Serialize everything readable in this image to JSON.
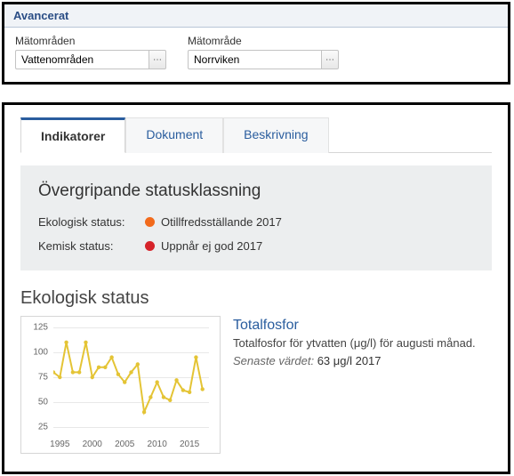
{
  "top": {
    "header": "Avancerat",
    "field1_label": "Mätområden",
    "field1_value": "Vattenområden",
    "field2_label": "Mätområde",
    "field2_value": "Norrviken"
  },
  "tabs": [
    {
      "label": "Indikatorer"
    },
    {
      "label": "Dokument"
    },
    {
      "label": "Beskrivning"
    }
  ],
  "status": {
    "title": "Övergripande statusklassning",
    "eco_label": "Ekologisk status:",
    "eco_value": "Otillfredsställande 2017",
    "chem_label": "Kemisk status:",
    "chem_value": "Uppnår ej god 2017"
  },
  "section_heading": "Ekologisk status",
  "indicator": {
    "title": "Totalfosfor",
    "desc": "Totalfosfor för ytvatten (μg/l) för augusti månad.",
    "latest_label": "Senaste värdet:",
    "latest_value": "63 μg/l 2017"
  },
  "chart_data": {
    "type": "line",
    "xlabel": "",
    "ylabel": "",
    "ylim": [
      25,
      125
    ],
    "y_ticks": [
      25,
      50,
      75,
      100,
      125
    ],
    "x_ticks": [
      1995,
      2000,
      2005,
      2010,
      2015
    ],
    "x_range": [
      1994,
      2018
    ],
    "series": [
      {
        "name": "Totalfosfor",
        "color": "#e4c435",
        "x": [
          1994,
          1995,
          1996,
          1997,
          1998,
          1999,
          2000,
          2001,
          2002,
          2003,
          2004,
          2005,
          2006,
          2007,
          2008,
          2009,
          2010,
          2011,
          2012,
          2013,
          2014,
          2015,
          2016,
          2017
        ],
        "y": [
          80,
          75,
          110,
          80,
          80,
          110,
          75,
          85,
          85,
          95,
          78,
          70,
          80,
          88,
          40,
          55,
          70,
          55,
          52,
          72,
          62,
          60,
          95,
          63
        ]
      }
    ]
  }
}
